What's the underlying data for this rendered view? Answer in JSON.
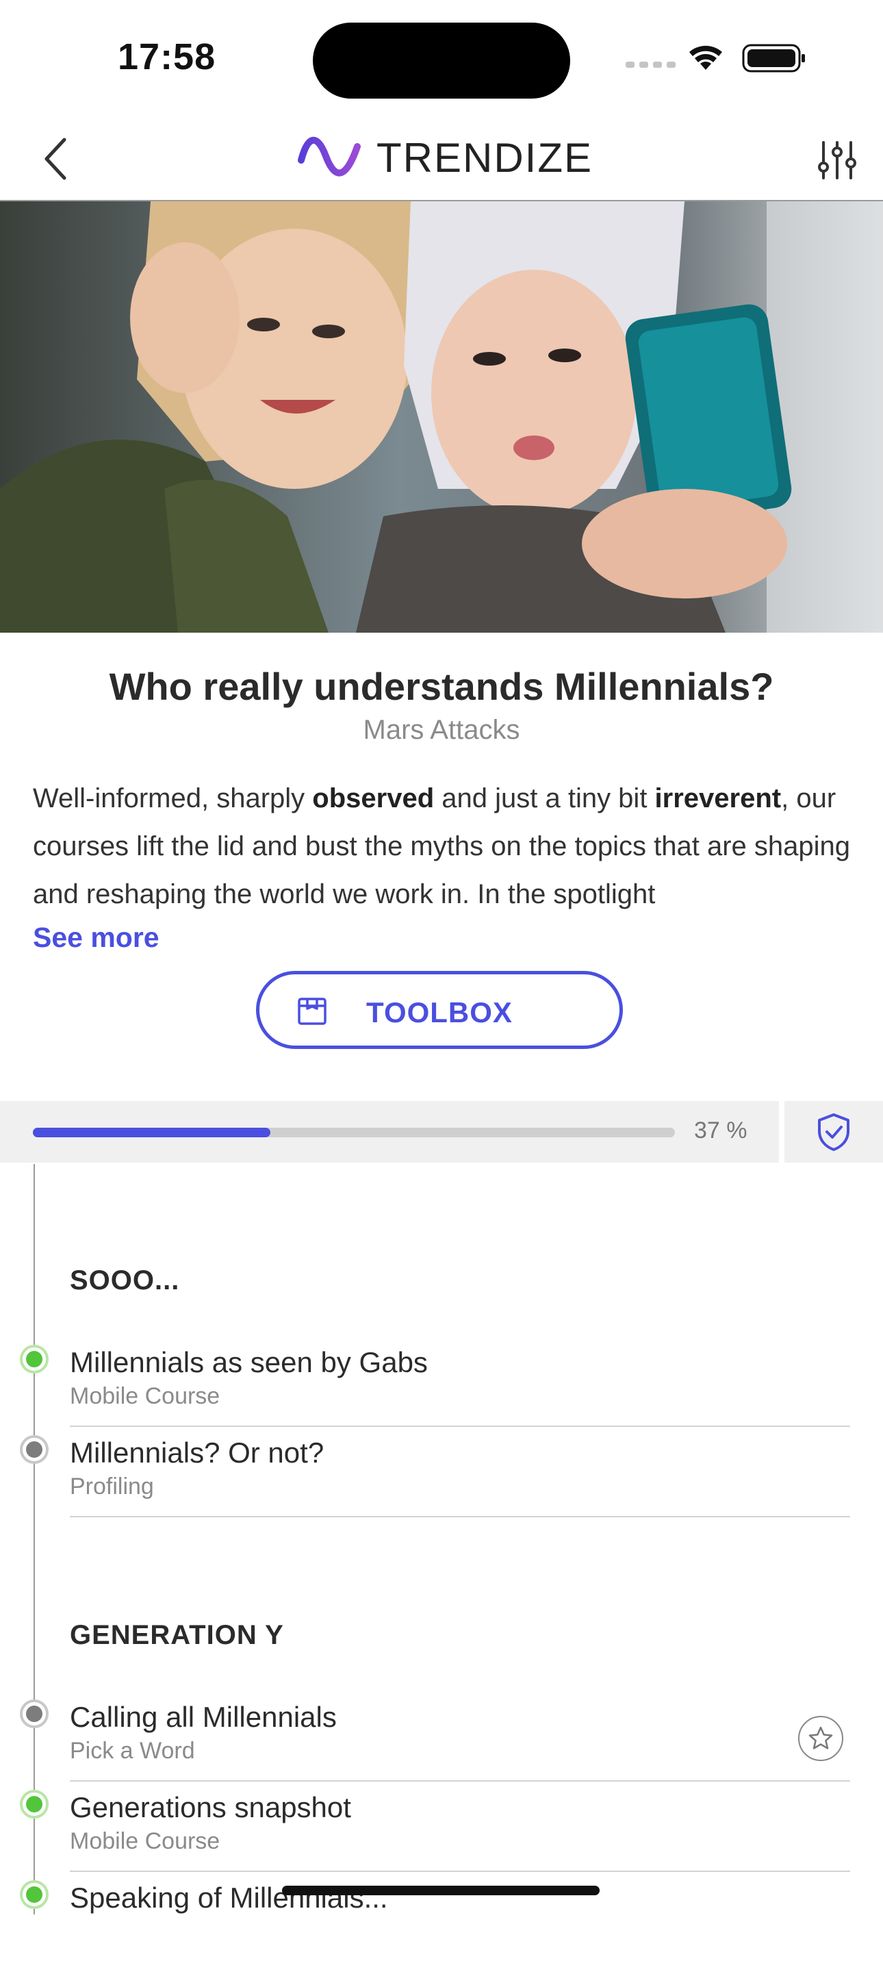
{
  "status_bar": {
    "time": "17:58"
  },
  "nav": {
    "brand": "TRENDIZE",
    "back_icon": "chevron-left-icon",
    "filter_icon": "sliders-icon"
  },
  "hero": {
    "image": "two women taking selfie photo"
  },
  "course": {
    "title": "Who really understands Millennials?",
    "subtitle": "Mars Attacks",
    "description": {
      "p1": "Well-informed, sharply ",
      "b1": "observed",
      "p2": " and just a tiny bit ",
      "b2": "irreverent",
      "p3": ", our courses lift the lid and bust the myths on the topics that are shaping and reshaping the world we work in. In the spotlight"
    },
    "see_more": "See more",
    "toolbox_label": "TOOLBOX"
  },
  "progress": {
    "percent": 37,
    "label": "37 %"
  },
  "sections": [
    {
      "title": "SOOO...",
      "items": [
        {
          "title": "Millennials as seen by Gabs",
          "type": "Mobile Course",
          "status": "completed"
        },
        {
          "title": "Millennials? Or not?",
          "type": "Profiling",
          "status": "not-started"
        }
      ]
    },
    {
      "title": "GENERATION Y",
      "items": [
        {
          "title": "Calling all Millennials",
          "type": "Pick a Word",
          "status": "not-started"
        },
        {
          "title": "Generations snapshot",
          "type": "Mobile Course",
          "status": "completed"
        },
        {
          "title": "Speaking of Millennials...",
          "type": "",
          "status": "completed"
        }
      ]
    }
  ],
  "colors": {
    "accent": "#4a4fe0",
    "completed": "#52c53a",
    "pending": "#7d7d7d"
  }
}
